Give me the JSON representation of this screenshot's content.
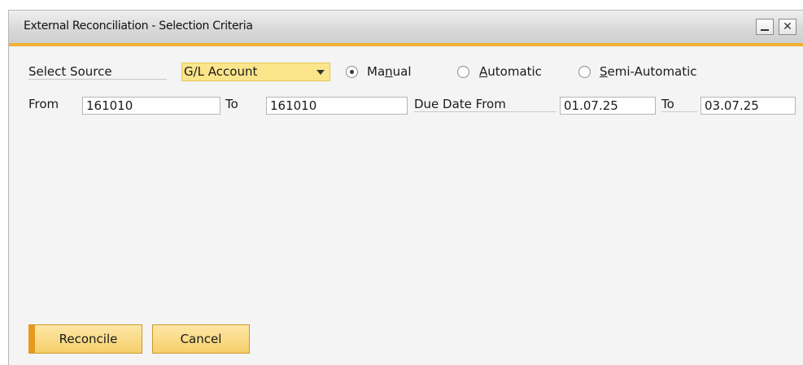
{
  "window": {
    "title": "External Reconciliation - Selection Criteria",
    "minimize_icon": "minimize-icon",
    "close_icon": "close-icon"
  },
  "row1": {
    "select_source_label": "Select Source",
    "source_value": "G/L Account",
    "radios": [
      {
        "label": "Manual",
        "underlined_letter": "n",
        "checked": true
      },
      {
        "label": "Automatic",
        "underlined_letter": "A",
        "checked": false
      },
      {
        "label": "Semi-Automatic",
        "underlined_letter": "S",
        "checked": false
      }
    ]
  },
  "row2": {
    "from_label": "From",
    "from_value": "161010",
    "to_label": "To",
    "to_value": "161010",
    "due_date_from_label": "Due Date From",
    "due_date_from_value": "01.07.25",
    "due_to_label": "To",
    "due_to_value": "03.07.25"
  },
  "buttons": {
    "reconcile_label": "Reconcile",
    "cancel_label": "Cancel"
  },
  "colors": {
    "accent": "#f2b233",
    "dropdown_bg": "#fbe58a",
    "button_bg": "#f6cf6b"
  }
}
